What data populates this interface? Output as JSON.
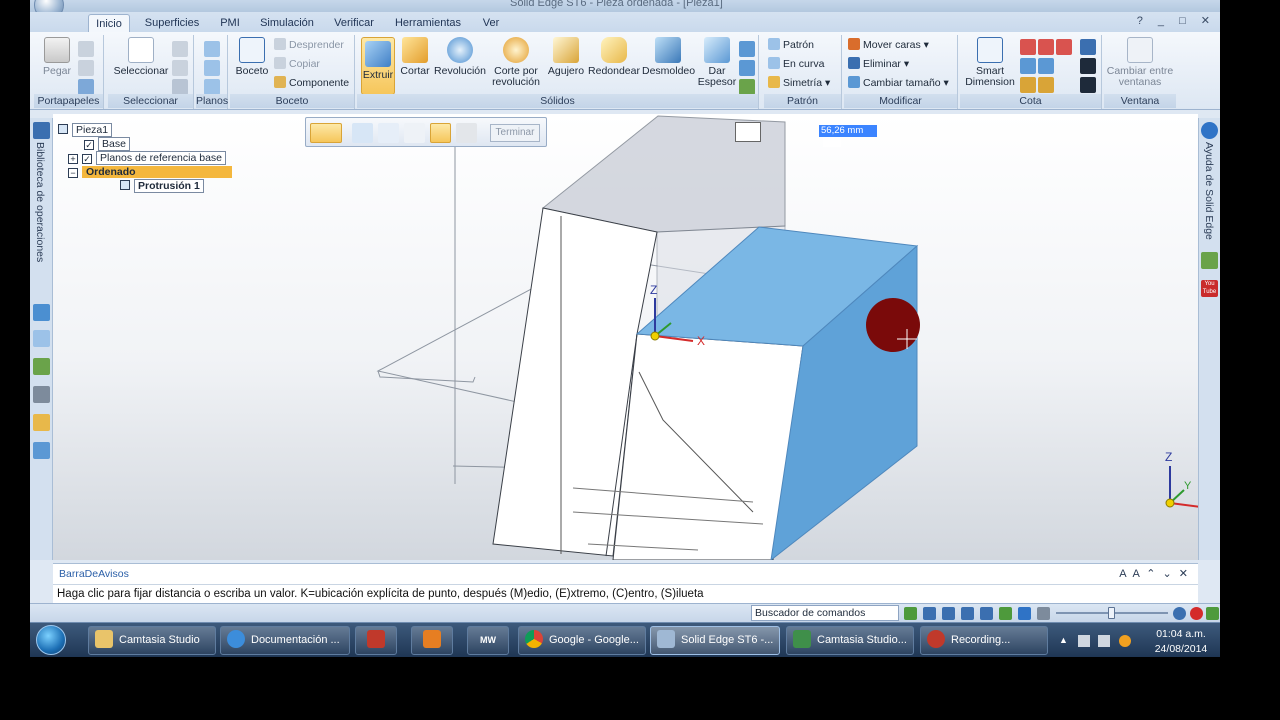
{
  "window": {
    "title": "Solid Edge ST6 - Pieza ordenada - [Pieza1]"
  },
  "tabs": [
    "Inicio",
    "Superficies",
    "PMI",
    "Simulación",
    "Verificar",
    "Herramientas",
    "Ver"
  ],
  "window_controls": "? _ □ ✕",
  "ribbon": {
    "portapapeles": {
      "label": "Portapapeles",
      "pegar": "Pegar"
    },
    "seleccionar": {
      "label": "Seleccionar",
      "seleccionar": "Seleccionar"
    },
    "planos": {
      "label": "Planos"
    },
    "boceto": {
      "label": "Boceto",
      "boceto": "Boceto",
      "desprender": "Desprender",
      "copiar": "Copiar",
      "componente": "Componente"
    },
    "solidos": {
      "label": "Sólidos",
      "extruir": "Extruir",
      "cortar": "Cortar",
      "revolucion": "Revolución",
      "corte_line1": "Corte por",
      "corte_line2": "revolución",
      "agujero": "Agujero",
      "redondear": "Redondear",
      "desmoldeo": "Desmoldeo",
      "dar_line1": "Dar",
      "dar_line2": "Espesor"
    },
    "patron": {
      "label": "Patrón",
      "patron": "Patrón",
      "en_curva": "En curva",
      "simetria": "Simetría"
    },
    "modificar": {
      "label": "Modificar",
      "mover_caras": "Mover caras",
      "eliminar": "Eliminar",
      "cambiar_tamano": "Cambiar tamaño"
    },
    "cota": {
      "label": "Cota",
      "smart_line1": "Smart",
      "smart_line2": "Dimension"
    },
    "ventana": {
      "label": "Ventana",
      "cambiar_line1": "Cambiar entre",
      "cambiar_line2": "ventanas"
    }
  },
  "left_dock": {
    "label": "Biblioteca de operaciones"
  },
  "right_dock": {
    "label": "Ayuda de Solid Edge",
    "youtube": "You Tube"
  },
  "tree": {
    "root": "Pieza1",
    "base": "Base",
    "planos": "Planos de referencia base",
    "ordenado": "Ordenado",
    "protrusion": "Protrusión 1"
  },
  "command_bar": {
    "terminar": "Terminar"
  },
  "dimension": {
    "value": "56,26 mm"
  },
  "axes": {
    "x": "X",
    "y": "Y",
    "z": "Z"
  },
  "prompt": {
    "title": "BarraDeAvisos",
    "text": "Haga clic para fijar distancia o escriba un valor. K=ubicación explícita de punto, después (M)edio, (E)xtremo, (C)entro, (S)ilueta",
    "controls": "A A ⌃ ⌄ ✕"
  },
  "statusbar": {
    "command_finder": "Buscador de comandos"
  },
  "taskbar": {
    "items": [
      "Camtasia Studio",
      "Documentación ...",
      "Google - Google...",
      "Solid Edge ST6 -...",
      "Camtasia Studio...",
      "Recording..."
    ],
    "mw_label": "MW"
  },
  "clock": {
    "time": "01:04 a.m.",
    "date": "24/08/2014"
  },
  "colors": {
    "accent": "#f6c65b",
    "model_face": "#79b4e3",
    "ribbon": "#dde7f3",
    "taskbar": "#1f3654"
  }
}
